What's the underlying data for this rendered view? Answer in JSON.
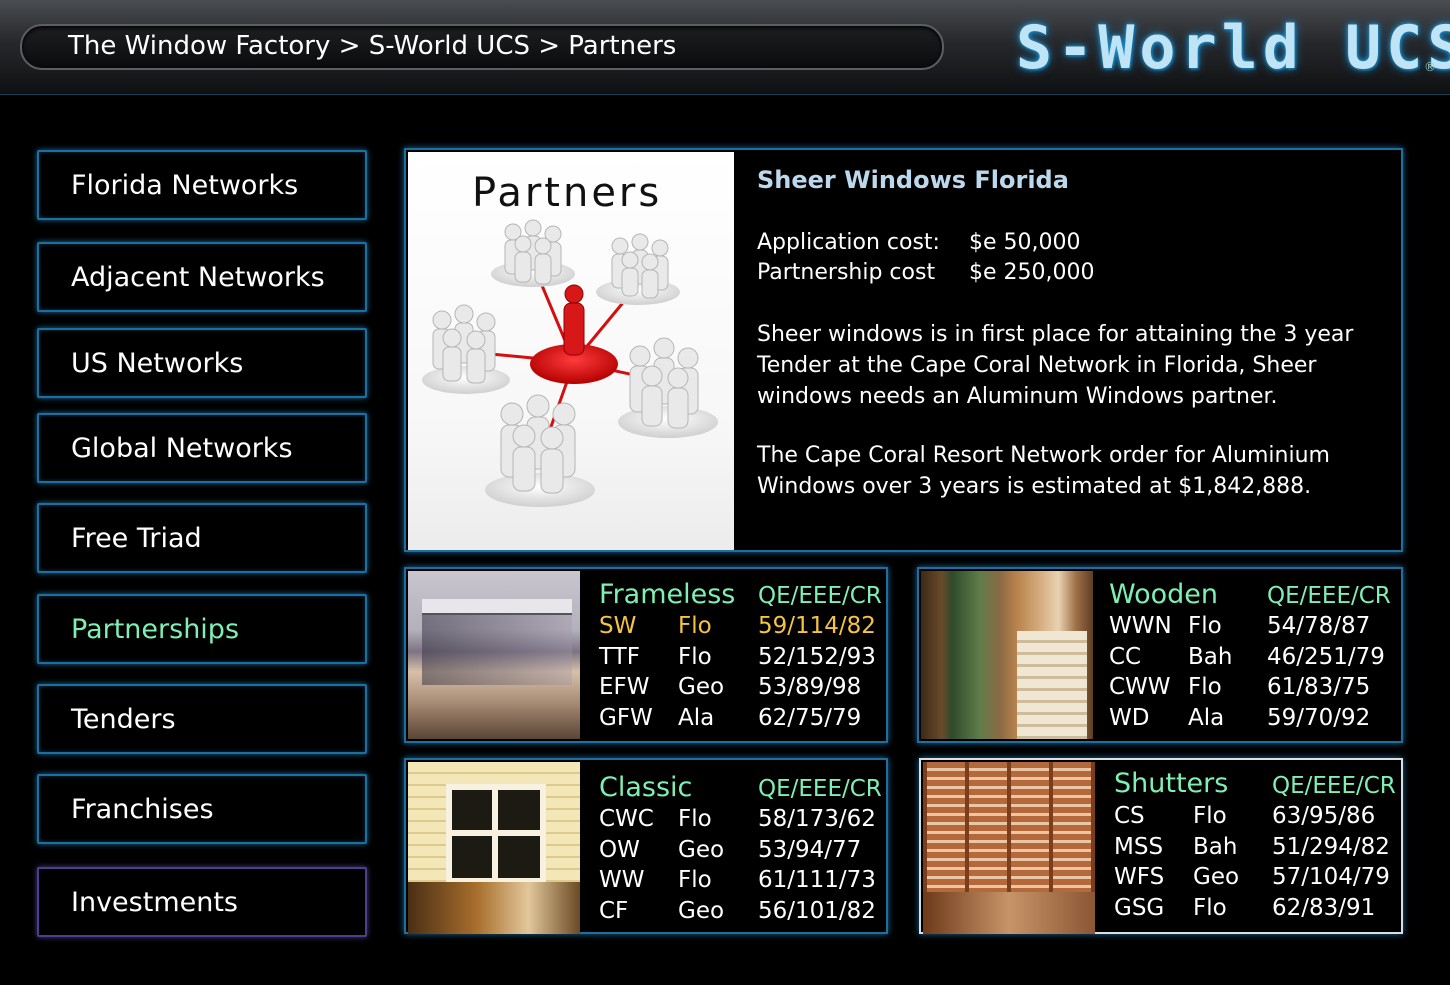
{
  "header": {
    "breadcrumb": "The Window Factory > S-World UCS > Partners",
    "logo": "S-World UCS",
    "reg_mark": "®"
  },
  "nav": {
    "items": [
      {
        "label": "Florida Networks"
      },
      {
        "label": "Adjacent Networks"
      },
      {
        "label": "US Networks"
      },
      {
        "label": "Global Networks"
      },
      {
        "label": "Free Triad"
      },
      {
        "label": "Partnerships"
      },
      {
        "label": "Tenders"
      },
      {
        "label": "Franchises"
      },
      {
        "label": "Investments"
      }
    ],
    "active": "Partnerships"
  },
  "partner": {
    "image_title": "Partners",
    "title": "Sheer Windows Florida",
    "application_label": "Application cost:",
    "application_value": "$e 50,000",
    "partnership_label": "Partnership cost",
    "partnership_value": "$e 250,000",
    "para1": "Sheer windows is in first place for attaining the 3 year Tender at the Cape Coral Network in Florida, Sheer windows needs an Aluminum Windows partner.",
    "para2": "The Cape Coral Resort Network order for Aluminium Windows over 3 years is estimated at $1,842,888."
  },
  "cards": [
    {
      "title": "Frameless",
      "header": "QE/EEE/CR",
      "rows": [
        {
          "code": "SW",
          "region": "Flo",
          "score": "59/114/82",
          "highlight": true
        },
        {
          "code": "TTF",
          "region": "Flo",
          "score": "52/152/93"
        },
        {
          "code": "EFW",
          "region": "Geo",
          "score": "53/89/98"
        },
        {
          "code": "GFW",
          "region": "Ala",
          "score": "62/75/79"
        }
      ]
    },
    {
      "title": "Wooden",
      "header": "QE/EEE/CR",
      "rows": [
        {
          "code": "WWN",
          "region": "Flo",
          "score": "54/78/87"
        },
        {
          "code": "CC",
          "region": "Bah",
          "score": "46/251/79"
        },
        {
          "code": "CWW",
          "region": "Flo",
          "score": "61/83/75"
        },
        {
          "code": "WD",
          "region": "Ala",
          "score": "59/70/92"
        }
      ]
    },
    {
      "title": "Classic",
      "header": "QE/EEE/CR",
      "rows": [
        {
          "code": "CWC",
          "region": "Flo",
          "score": "58/173/62"
        },
        {
          "code": "OW",
          "region": "Geo",
          "score": "53/94/77"
        },
        {
          "code": "WW",
          "region": "Flo",
          "score": "61/111/73"
        },
        {
          "code": "CF",
          "region": "Geo",
          "score": "56/101/82"
        }
      ]
    },
    {
      "title": "Shutters",
      "header": "QE/EEE/CR",
      "rows": [
        {
          "code": "CS",
          "region": "Flo",
          "score": "63/95/86"
        },
        {
          "code": "MSS",
          "region": "Bah",
          "score": "51/294/82"
        },
        {
          "code": "WFS",
          "region": "Geo",
          "score": "57/104/79"
        },
        {
          "code": "GSG",
          "region": "Flo",
          "score": "62/83/91"
        }
      ]
    }
  ]
}
